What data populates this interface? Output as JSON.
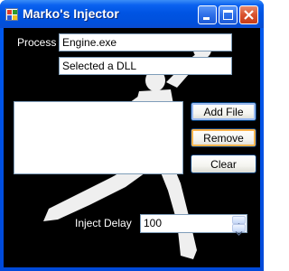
{
  "window": {
    "title": "Marko's Injector"
  },
  "icons": {
    "app": "app-window-icon",
    "minimize": "minimize-icon",
    "maximize": "maximize-icon",
    "close": "close-icon",
    "spin_up": "arrow-up-icon",
    "spin_down": "arrow-down-icon"
  },
  "form": {
    "process_label": "Process",
    "process_value": "Engine.exe",
    "dll_status": "Selected a DLL",
    "buttons": {
      "add": "Add File",
      "remove": "Remove",
      "clear": "Clear"
    },
    "delay_label": "Inject Delay",
    "delay_value": "100"
  },
  "colors": {
    "titlebar": "#0054e3",
    "background": "#000000",
    "hover_border": "#f8b34c"
  }
}
